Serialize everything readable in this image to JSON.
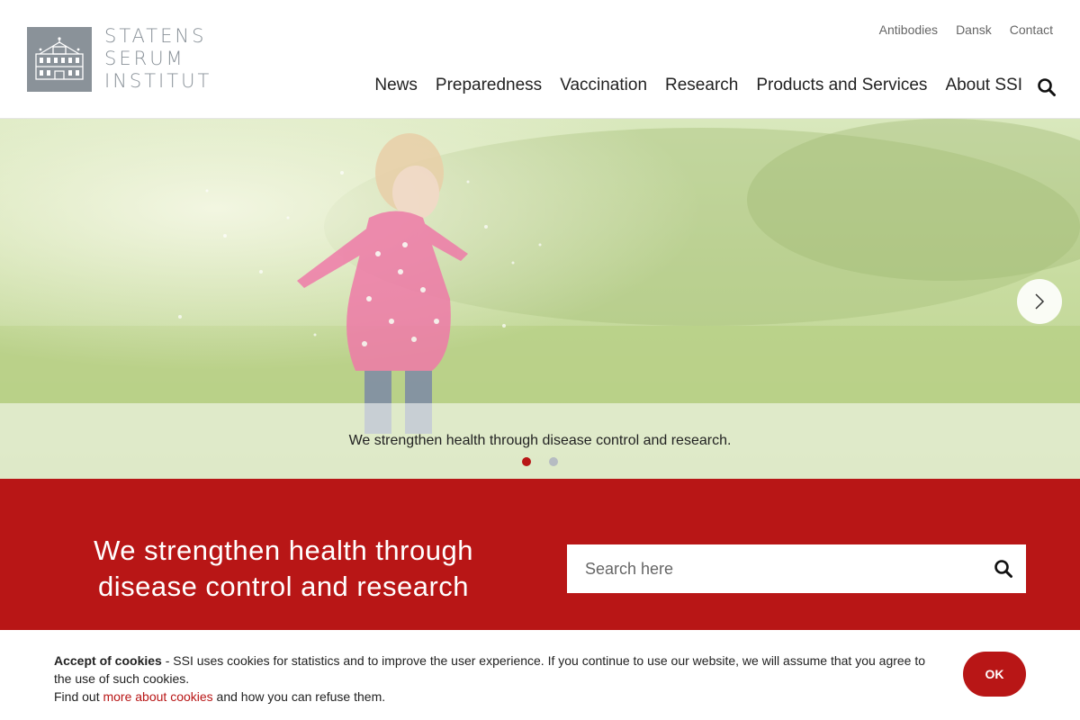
{
  "brand": {
    "line1": "STATENS",
    "line2": "SERUM",
    "line3": "INSTITUT"
  },
  "top_links": [
    "Antibodies",
    "Dansk",
    "Contact"
  ],
  "nav": [
    "News",
    "Preparedness",
    "Vaccination",
    "Research",
    "Products and Services",
    "About SSI"
  ],
  "hero": {
    "caption": "We strengthen health through disease control and research.",
    "slides": 2,
    "active_slide": 1
  },
  "band": {
    "title_line1": "We strengthen health through",
    "title_line2": "disease control and research"
  },
  "search": {
    "placeholder": "Search here",
    "value": ""
  },
  "cookie": {
    "title": "Accept of cookies",
    "text": " - SSI uses cookies for statistics and to improve the user experience. If you continue to use our website, we will assume that you agree to the use of such cookies.",
    "find_out": "Find out ",
    "link": "more about cookies",
    "after_link": " and how you can refuse them.",
    "ok": "OK"
  },
  "icons": {
    "search": "search-icon",
    "next": "chevron-right-icon"
  },
  "colors": {
    "brand_red": "#b81616",
    "logo_grey": "#8a9299"
  }
}
